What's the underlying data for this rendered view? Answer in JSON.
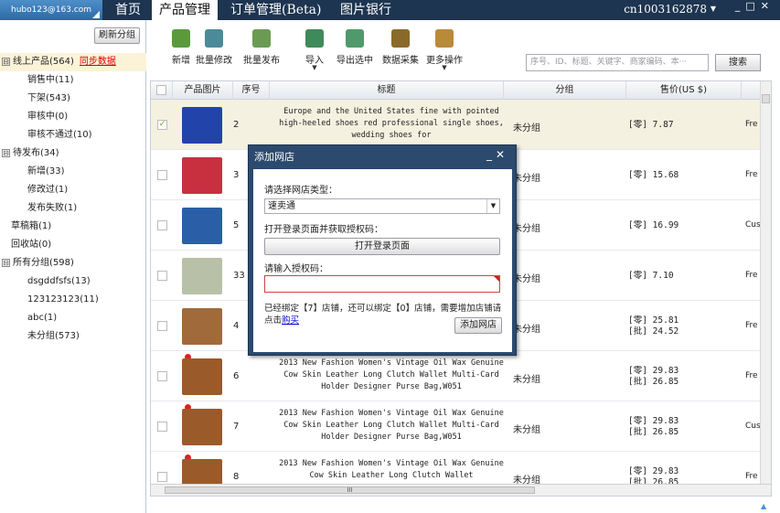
{
  "topbar": {
    "account": "hubo123@163.com",
    "tabs": [
      "首页",
      "产品管理",
      "订单管理(Beta)",
      "图片银行"
    ],
    "user": "cn1003162878",
    "user_dropdown": "▼",
    "window_controls": "_□✕"
  },
  "sidebar": {
    "refresh_label": "刷新分组",
    "tree": [
      {
        "label": "线上产品(564)",
        "expander": "⊟",
        "level": 0,
        "selected": true,
        "extra": "同步数据"
      },
      {
        "label": "销售中(11)",
        "level": 1
      },
      {
        "label": "下架(543)",
        "level": 1
      },
      {
        "label": "审核中(0)",
        "level": 1
      },
      {
        "label": "审核不通过(10)",
        "level": 1
      },
      {
        "label": "待发布(34)",
        "expander": "⊟",
        "level": 0
      },
      {
        "label": "新增(33)",
        "level": 1
      },
      {
        "label": "修改过(1)",
        "level": 1
      },
      {
        "label": "发布失败(1)",
        "level": 1
      },
      {
        "label": "草稿箱(1)",
        "level": 0
      },
      {
        "label": "回收站(0)",
        "level": 0
      },
      {
        "label": "所有分组(598)",
        "expander": "⊟",
        "level": 0
      },
      {
        "label": "dsgddfsfs(13)",
        "level": 1
      },
      {
        "label": "123123123(11)",
        "level": 1
      },
      {
        "label": "abc(1)",
        "level": 1
      },
      {
        "label": "未分组(573)",
        "level": 1
      }
    ]
  },
  "toolbar": {
    "buttons": [
      {
        "label": "新增",
        "icon": "add-icon",
        "color": "#5a9a3c"
      },
      {
        "label": "批量修改",
        "icon": "edit-icon",
        "color": "#4c8a9a"
      },
      {
        "label": "批量发布",
        "icon": "publish-icon",
        "color": "#6b9b52"
      },
      {
        "label": "导入",
        "icon": "import-icon",
        "color": "#3f8a5a",
        "dropdown": true
      },
      {
        "label": "导出选中",
        "icon": "export-icon",
        "color": "#4f9a6a"
      },
      {
        "label": "数据采集",
        "icon": "collect-icon",
        "color": "#8a6a2a"
      },
      {
        "label": "更多操作",
        "icon": "more-icon",
        "color": "#b88a3a",
        "dropdown": true
      }
    ],
    "search_placeholder": "序号、ID、标题、关键字、商家编码、本···",
    "search_button": "搜索"
  },
  "table": {
    "columns": [
      "",
      "产品图片",
      "序号",
      "标题",
      "分组",
      "售价(US $)",
      ""
    ],
    "rows": [
      {
        "checked": true,
        "seq": "2",
        "title": "Europe and the United States fine with pointed high-heeled shoes red professional single shoes, wedding shoes for",
        "group": "未分组",
        "price1": "[零] 7.87",
        "price2": "",
        "last": "Fre",
        "img_color": "#2244aa"
      },
      {
        "checked": false,
        "seq": "3",
        "title": "",
        "group": "未分组",
        "price1": "[零] 15.68",
        "price2": "",
        "last": "Fre",
        "img_color": "#c83040"
      },
      {
        "checked": false,
        "seq": "5",
        "title": "",
        "group": "未分组",
        "price1": "[零] 16.99",
        "price2": "",
        "last": "Cus",
        "img_color": "#2a5fa8"
      },
      {
        "checked": false,
        "seq": "33",
        "title": "",
        "group": "未分组",
        "price1": "[零] 7.10",
        "price2": "",
        "last": "Fre",
        "img_color": "#b8c0a8"
      },
      {
        "checked": false,
        "seq": "4",
        "title": "",
        "group": "未分组",
        "price1": "[零] 25.81",
        "price2": "[批] 24.52",
        "last": "Fre",
        "img_color": "#a06a3a"
      },
      {
        "checked": false,
        "seq": "6",
        "title": "2013 New Fashion Women's Vintage Oil Wax Genuine Cow Skin Leather Long Clutch Wallet Multi-Card Holder Designer Purse Bag,W051",
        "group": "未分组",
        "price1": "[零] 29.83",
        "price2": "[批] 26.85",
        "last": "Fre",
        "img_color": "#9a5a2a",
        "dot": true
      },
      {
        "checked": false,
        "seq": "7",
        "title": "2013 New Fashion Women's Vintage Oil Wax Genuine Cow Skin Leather Long Clutch Wallet Multi-Card Holder Designer Purse Bag,W051",
        "group": "未分组",
        "price1": "[零] 29.83",
        "price2": "[批] 26.85",
        "last": "Cus",
        "img_color": "#9a5a2a",
        "dot": true
      },
      {
        "checked": false,
        "seq": "8",
        "title": "2013 New Fashion Women's Vintage Oil Wax Genuine Cow Skin Leather Long Clutch Wallet",
        "group": "未分组",
        "price1": "[零] 29.83",
        "price2": "[批] 26.85",
        "last": "Fre",
        "img_color": "#9a5a2a",
        "dot": true
      }
    ],
    "hscroll_label": "III"
  },
  "dialog": {
    "title": "添加网店",
    "controls": "_✕",
    "type_label": "请选择网店类型：",
    "type_value": "速卖通",
    "login_label": "打开登录页面并获取授权码：",
    "open_login_button": "打开登录页面",
    "auth_label": "请输入授权码：",
    "info_text": "已经绑定【7】店铺，还可以绑定【0】店铺，需要增加店铺请点击",
    "buy_link": "购买",
    "add_button": "添加网店"
  },
  "footer": {
    "triangle": "▲"
  }
}
